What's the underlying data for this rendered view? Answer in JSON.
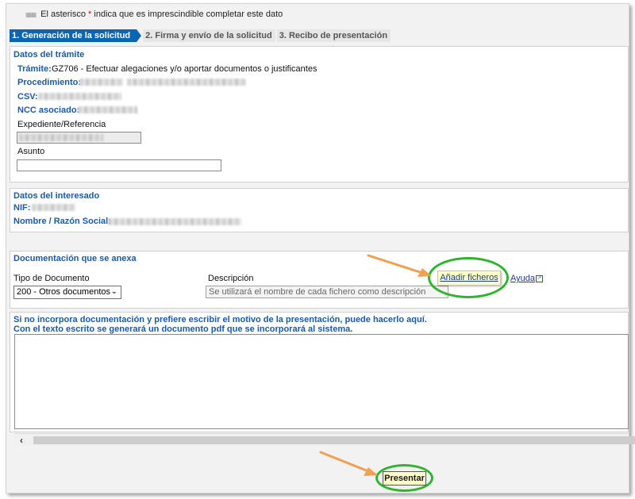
{
  "notice": {
    "before": "El asterisco ",
    "asterisk": "*",
    "after": " indica que es imprescindible completar este dato"
  },
  "tabs": [
    "1. Generación de la solicitud",
    "2. Firma y envío de la solicitud",
    "3. Recibo de presentación"
  ],
  "tramite": {
    "title": "Datos del trámite",
    "tramite_label": "Trámite:",
    "tramite_value": "GZ706 - Efectuar alegaciones y/o aportar documentos o justificantes",
    "procedimiento_label": "Procedimiento:",
    "csv_label": "CSV:",
    "ncc_label": "NCC asociado:",
    "expediente_label": "Expediente/Referencia",
    "asunto_label": "Asunto"
  },
  "interesado": {
    "title": "Datos del interesado",
    "nif_label": "NIF:",
    "nombre_label": "Nombre / Razón Social:"
  },
  "documentacion": {
    "title": "Documentación que se anexa",
    "tipo_label": "Tipo de Documento",
    "tipo_value": "200 - Otros documentos",
    "descripcion_label": "Descripción",
    "descripcion_placeholder": "Se utilizará el nombre de cada fichero como descripción",
    "add_files_label": "Añadir ficheros",
    "help_label": "Ayuda"
  },
  "motivo": {
    "line1": "Si no incorpora documentación y prefiere escribir el motivo de la presentación, puede hacerlo aquí.",
    "line2": "Con el texto escrito se generará un documento pdf que se incorporará al sistema."
  },
  "submit_label": "Presentar",
  "colors": {
    "accent": "#0a65b5",
    "label": "#1a5aa6",
    "highlight_ring": "#2db52d",
    "arrow": "#f0a050"
  },
  "icons": [
    "bullet-icon",
    "chevron-down-icon",
    "external-link-icon",
    "chevron-left-icon",
    "arrow-pointer-icon"
  ]
}
